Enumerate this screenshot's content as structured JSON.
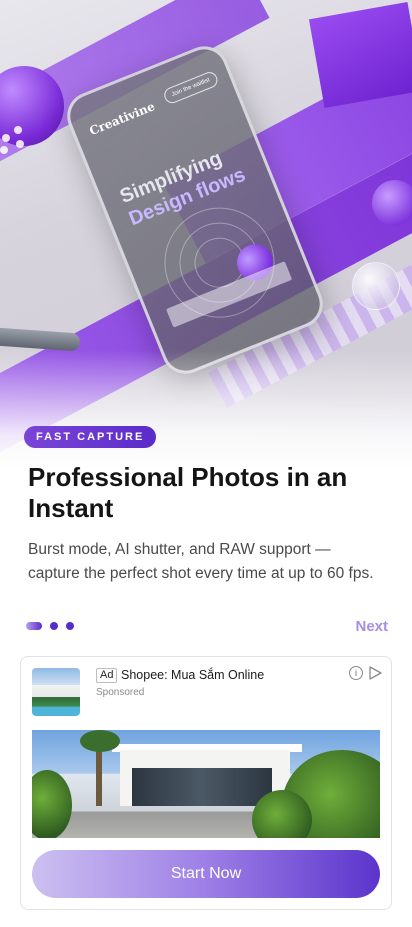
{
  "hero": {
    "phone_brand": "Creativine",
    "phone_button": "Join the waitlist",
    "phone_headline_1": "Simplifying",
    "phone_headline_2": "Design flows"
  },
  "onboarding": {
    "badge": "FAST CAPTURE",
    "title": "Professional Photos in an Instant",
    "description": "Burst mode, AI shutter, and RAW support — capture the perfect shot every time at up to 60 fps.",
    "next_label": "Next",
    "page_count": 3,
    "current_page": 1
  },
  "ad": {
    "tag": "Ad",
    "advertiser": "Shopee: Mua Sắm Online",
    "sponsored": "Sponsored",
    "info_icon": "info-icon",
    "adchoices_icon": "adchoices-icon",
    "cta_label": "Start Now"
  },
  "colors": {
    "accent": "#5b2bc9",
    "accent_light": "#a88de6",
    "text_primary": "#151515",
    "text_secondary": "#4a4a4a"
  }
}
